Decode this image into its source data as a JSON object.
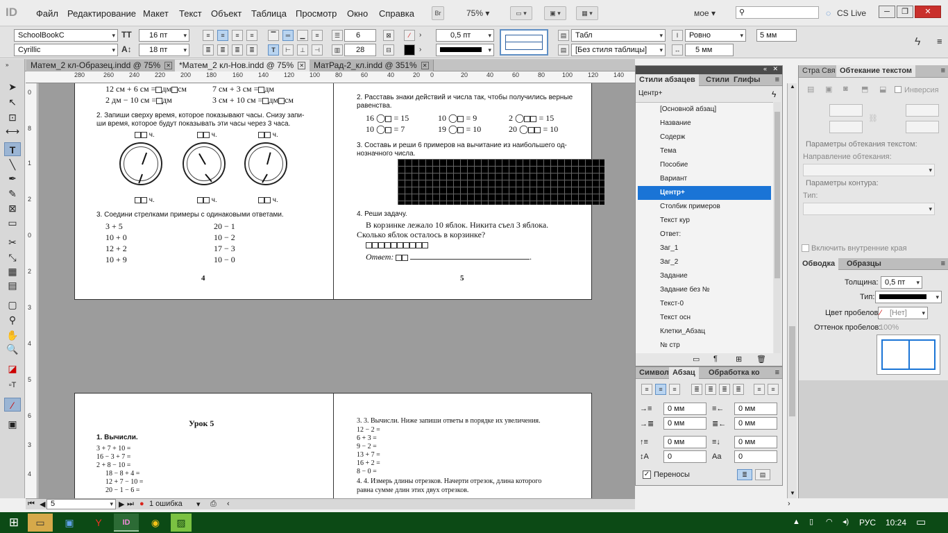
{
  "menubar": {
    "logo": "ID",
    "items": [
      "Файл",
      "Редактирование",
      "Макет",
      "Текст",
      "Объект",
      "Таблица",
      "Просмотр",
      "Окно",
      "Справка"
    ],
    "bridge": "Br",
    "zoom": "75%",
    "workspace": "мое",
    "cslive": "CS Live"
  },
  "control": {
    "font": "SchoolBookC",
    "style": "Cyrillic",
    "size": "16 пт",
    "leading": "18 пт",
    "columns": "6",
    "rows": "28",
    "stroke_weight": "0,5 пт",
    "tab_label": "Табл",
    "table_style": "[Без стиля таблицы]",
    "align": "Ровно",
    "height1": "5 мм",
    "height2": "5 мм"
  },
  "doc_tabs": [
    {
      "label": "Матем_2 кл-Образец.indd @ 75%",
      "active": false
    },
    {
      "label": "*Матем_2 кл-Нов.indd @ 75%",
      "active": true
    },
    {
      "label": "МатРад-2_кл.indd @ 351%",
      "active": false
    }
  ],
  "ruler_h": [
    "280",
    "260",
    "240",
    "220",
    "200",
    "180",
    "160",
    "140",
    "120",
    "100",
    "80",
    "60",
    "40",
    "20",
    "0",
    "20",
    "40",
    "60",
    "80",
    "100",
    "120",
    "140"
  ],
  "ruler_v": [
    "0",
    "8",
    "1",
    "2",
    "0",
    "2",
    "3",
    "4",
    "5",
    "6",
    "3",
    "4"
  ],
  "page4": {
    "r1a": "12 см + 6 см =",
    "r1b": "дм",
    "r1c": "см",
    "r1d": "7 см + 3 см =",
    "r1e": "дм",
    "r2a": "2 дм − 10 см =",
    "r2b": "дм",
    "r2c": "3 см + 10 см =",
    "r2d": "дм",
    "r2e": "см",
    "t2": "2. Запиши сверху время, которое показывают часы. Снизу запи-",
    "t2b": "ши время, которое будут показывать эти часы через 3 часа.",
    "ch": "ч.",
    "t3": "3. Соедини стрелками примеры с одинаковыми ответами.",
    "left": [
      "3 + 5",
      "10 + 0",
      "12 + 2",
      "10 + 9"
    ],
    "right": [
      "20 − 1",
      "10 − 2",
      "17 − 3",
      "10 − 0"
    ],
    "num": "4"
  },
  "page5": {
    "t2": "2. Расставь знаки действий и числа так, чтобы получились верные",
    "t2b": "равенства.",
    "eq": [
      "16",
      "= 15",
      "10",
      "= 9",
      "2",
      "= 15",
      "10",
      "= 7",
      "19",
      "= 10",
      "20",
      "= 10"
    ],
    "t3": "3. Составь и реши 6 примеров на вычитание из наибольшего од-",
    "t3b": "нозначного числа.",
    "t4": "4. Реши задачу.",
    "t4a": "В корзинке лежало 10 яблок. Никита съел 3 яблока.",
    "t4b": "Сколько яблок осталось в корзинке?",
    "ans": "Ответ:",
    "num": "5"
  },
  "page6": {
    "title": "Урок 5",
    "t1": "1. Вычисли.",
    "lines": [
      "3 + 7 + 10 =",
      "16 − 3 + 7 =",
      "2 + 8 − 10 =",
      "18 − 8 + 4 =",
      "12 + 7 − 10 =",
      "20 − 1 − 6 ="
    ]
  },
  "page7": {
    "t3": "3.      3. Вычисли. Ниже запиши ответы в порядке их увеличения.",
    "lines": [
      "12 − 2 =",
      "6 + 3 =",
      "9 − 2 =",
      "13 + 7 =",
      "16 + 2 =",
      "8 − 0 ="
    ],
    "t4": "4.      4. Измерь длины отрезков. Начерти отрезок, длина которого",
    "t4b": "равна сумме длин этих двух отрезков."
  },
  "status": {
    "page": "5",
    "errors": "1 ошибка"
  },
  "pstyles": {
    "tabs": [
      "Стили абзацев",
      "Стили",
      "Глифы"
    ],
    "current": "Центр+",
    "items": [
      "[Основной абзац]",
      "Название",
      "Содерж",
      "Тема",
      "Пособие",
      "Вариант",
      "Центр+",
      "Столбик примеров",
      "Текст кур",
      "Ответ:",
      "Заг_1",
      "Заг_2",
      "Задание",
      "Задание без №",
      "Текст-0",
      "Текст осн",
      "Клетки_Абзац",
      "№ стр"
    ],
    "selected_index": 6
  },
  "wrap": {
    "tabs": [
      "Стра",
      "Свя",
      "Обтекание текстом"
    ],
    "inversion": "Инверсия",
    "params": "Параметры обтекания текстом:",
    "direction": "Направление обтекания:",
    "contour": "Параметры контура:",
    "type": "Тип:",
    "include": "Включить внутренние края"
  },
  "stroke": {
    "tabs": [
      "Обводка",
      "Образцы"
    ],
    "weight_label": "Толщина:",
    "weight": "0,5 пт",
    "type_label": "Тип:",
    "gap_color_label": "Цвет пробелов:",
    "gap_color": "[Нет]",
    "gap_tint_label": "Оттенок пробелов:",
    "gap_tint": "100%"
  },
  "para": {
    "tabs": [
      "Символ",
      "Абзац",
      "Обработка ко"
    ],
    "fields": [
      "0 мм",
      "0 мм",
      "0 мм",
      "0 мм",
      "0 мм",
      "0 мм",
      "0",
      "0"
    ],
    "hyphen": "Переносы"
  },
  "taskbar": {
    "lang": "РУС",
    "time": "10:24"
  }
}
